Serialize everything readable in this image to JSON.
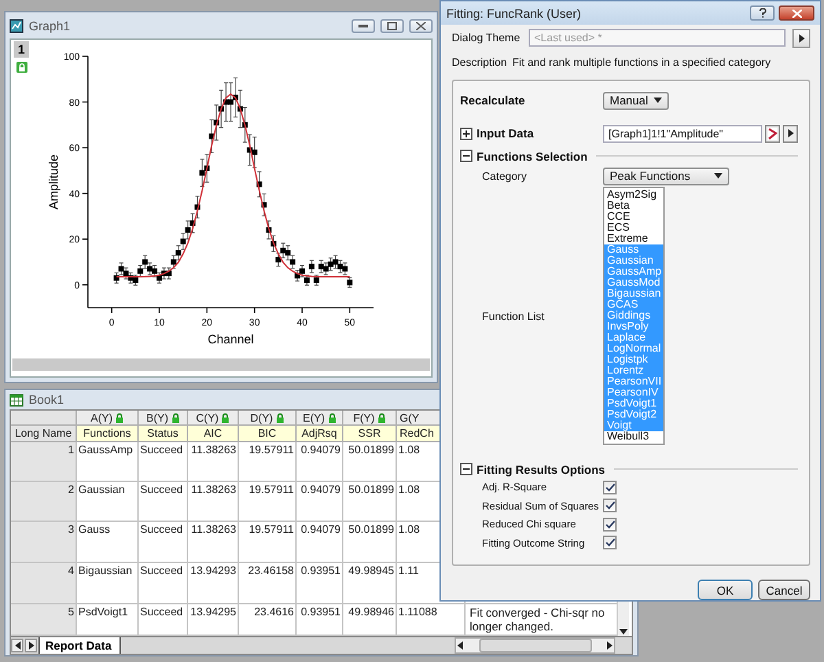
{
  "graph_window": {
    "title": "Graph1",
    "layer": "1",
    "chart_data": {
      "type": "scatter",
      "xlabel": "Channel",
      "ylabel": "Amplitude",
      "xlim": [
        -5,
        55
      ],
      "ylim": [
        -10,
        100
      ],
      "xticks": [
        0,
        10,
        20,
        30,
        40,
        50
      ],
      "yticks": [
        0,
        20,
        40,
        60,
        80,
        100
      ],
      "x": [
        1,
        2,
        3,
        4,
        5,
        6,
        7,
        8,
        9,
        10,
        11,
        12,
        13,
        14,
        15,
        16,
        17,
        18,
        19,
        20,
        21,
        22,
        23,
        24,
        25,
        26,
        27,
        28,
        29,
        30,
        31,
        32,
        33,
        34,
        35,
        36,
        37,
        38,
        39,
        40,
        41,
        42,
        43,
        44,
        45,
        46,
        47,
        48,
        49,
        50
      ],
      "series": [
        {
          "color": "#000000",
          "values": [
            3,
            7,
            5,
            3,
            2,
            6,
            10,
            7,
            6,
            3,
            5,
            5,
            10,
            14,
            19,
            24,
            27,
            34,
            49,
            51,
            65,
            71,
            77,
            80,
            80,
            82,
            77,
            70,
            59,
            58,
            44,
            35,
            24,
            18,
            11,
            15,
            14,
            10,
            4,
            6,
            2,
            8,
            2,
            8,
            7,
            9,
            10,
            8,
            7,
            1
          ]
        },
        {
          "type": "line",
          "color": "#d03038",
          "values": [
            3.5,
            3.5,
            3.5,
            3.5,
            3.5,
            3.5,
            3.6,
            3.7,
            3.9,
            4.2,
            4.9,
            5.9,
            7.5,
            9.9,
            13.5,
            18.3,
            24.6,
            32.3,
            41.3,
            51,
            60.9,
            69.8,
            77.1,
            81.8,
            83.5,
            81.8,
            77.1,
            69.8,
            60.9,
            51,
            41.3,
            32.3,
            24.6,
            18.3,
            13.5,
            9.9,
            7.5,
            5.9,
            4.9,
            4.2,
            3.9,
            3.7,
            3.6,
            3.5,
            3.5,
            3.5,
            3.5,
            3.5,
            3.5,
            3.5
          ]
        }
      ]
    }
  },
  "book_window": {
    "title": "Book1",
    "row_label": "Long Name",
    "columns": [
      {
        "name": "A(Y)",
        "long_name": "Functions",
        "locked": true
      },
      {
        "name": "B(Y)",
        "long_name": "Status",
        "locked": true
      },
      {
        "name": "C(Y)",
        "long_name": "AIC",
        "locked": true
      },
      {
        "name": "D(Y)",
        "long_name": "BIC",
        "locked": true
      },
      {
        "name": "E(Y)",
        "long_name": "AdjRsq",
        "locked": true
      },
      {
        "name": "F(Y)",
        "long_name": "SSR",
        "locked": true
      },
      {
        "name": "G(Y",
        "long_name": "RedCh",
        "locked": false
      }
    ],
    "rows": [
      {
        "index": "1",
        "cells": [
          "GaussAmp",
          "Succeed",
          "11.38263",
          "19.57911",
          "0.94079",
          "50.01899",
          "1.08"
        ]
      },
      {
        "index": "2",
        "cells": [
          "Gaussian",
          "Succeed",
          "11.38263",
          "19.57911",
          "0.94079",
          "50.01899",
          "1.08"
        ]
      },
      {
        "index": "3",
        "cells": [
          "Gauss",
          "Succeed",
          "11.38263",
          "19.57911",
          "0.94079",
          "50.01899",
          "1.08"
        ]
      },
      {
        "index": "4",
        "cells": [
          "Bigaussian",
          "Succeed",
          "13.94293",
          "23.46158",
          "0.93951",
          "49.98945",
          "1.11"
        ]
      },
      {
        "index": "5",
        "cells": [
          "PsdVoigt1",
          "Succeed",
          "13.94295",
          "23.4616",
          "0.93951",
          "49.98946",
          "1.11088"
        ],
        "message": "Fit converged - Chi-sqr no longer changed."
      }
    ],
    "sheet_tab": "Report Data"
  },
  "dialog": {
    "title": "Fitting: FuncRank (User)",
    "theme_label": "Dialog Theme",
    "theme": {
      "placeholder": "<Last used> *"
    },
    "description_label": "Description",
    "description": "Fit and rank multiple  functions in a  specified category",
    "recalculate": {
      "label": "Recalculate",
      "value": "Manual"
    },
    "input_data": {
      "label": "Input Data",
      "expanded": false,
      "value": "[Graph1]1!1\"Amplitude\""
    },
    "functions_selection": {
      "label": "Functions Selection",
      "expanded": true,
      "category_label": "Category",
      "category": "Peak Functions",
      "list_label": "Function List",
      "functions": [
        {
          "label": "Asym2Sig",
          "selected": false
        },
        {
          "label": "Beta",
          "selected": false
        },
        {
          "label": "CCE",
          "selected": false
        },
        {
          "label": "ECS",
          "selected": false
        },
        {
          "label": "Extreme",
          "selected": false
        },
        {
          "label": "Gauss",
          "selected": true
        },
        {
          "label": "Gaussian",
          "selected": true
        },
        {
          "label": "GaussAmp",
          "selected": true
        },
        {
          "label": "GaussMod",
          "selected": true
        },
        {
          "label": "Bigaussian",
          "selected": true
        },
        {
          "label": "GCAS",
          "selected": true
        },
        {
          "label": "Giddings",
          "selected": true
        },
        {
          "label": "InvsPoly",
          "selected": true
        },
        {
          "label": "Laplace",
          "selected": true
        },
        {
          "label": "LogNormal",
          "selected": true
        },
        {
          "label": "Logistpk",
          "selected": true
        },
        {
          "label": "Lorentz",
          "selected": true
        },
        {
          "label": "PearsonVII",
          "selected": true
        },
        {
          "label": "PearsonIV",
          "selected": true
        },
        {
          "label": "PsdVoigt1",
          "selected": true
        },
        {
          "label": "PsdVoigt2",
          "selected": true
        },
        {
          "label": "Voigt",
          "selected": true
        },
        {
          "label": "Weibull3",
          "selected": false
        }
      ]
    },
    "results_options": {
      "label": "Fitting Results Options",
      "expanded": true,
      "options": [
        {
          "label": "Adj. R-Square",
          "checked": true
        },
        {
          "label": "Residual Sum of Squares",
          "checked": true
        },
        {
          "label": "Reduced Chi square",
          "checked": true
        },
        {
          "label": "Fitting Outcome String",
          "checked": true
        }
      ]
    },
    "buttons": [
      "OK",
      "Cancel"
    ]
  }
}
